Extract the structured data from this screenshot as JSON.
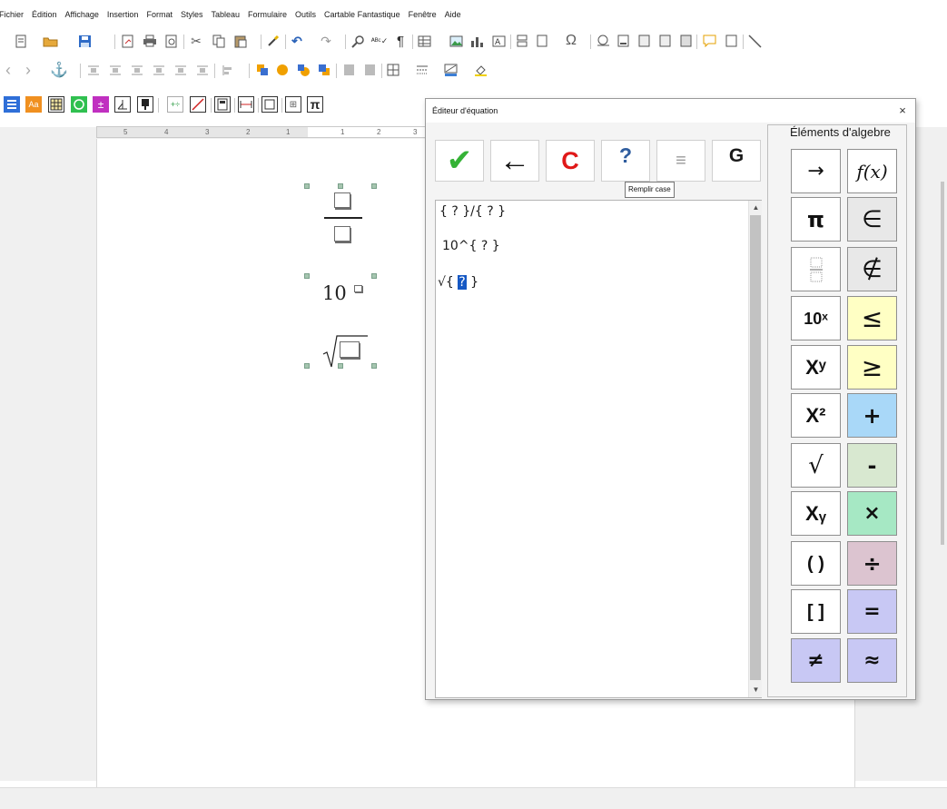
{
  "menubar": [
    "Fichier",
    "Édition",
    "Affichage",
    "Insertion",
    "Format",
    "Styles",
    "Tableau",
    "Formulaire",
    "Outils",
    "Cartable Fantastique",
    "Fenêtre",
    "Aide"
  ],
  "ruler": {
    "left_numbers": [
      "5",
      "4",
      "3",
      "2",
      "1"
    ],
    "right_numbers": [
      "1",
      "2",
      "3"
    ]
  },
  "document": {
    "power_base": "10"
  },
  "dialog": {
    "title": "Éditeur d'équation",
    "close_label": "×",
    "buttons": {
      "validate": "✔",
      "back": "←",
      "clear": "C",
      "help": "?",
      "align": "≡",
      "g": "G"
    },
    "tooltip": "Remplir case",
    "editor_lines": [
      "{ ? }/{ ? }",
      "10^{ ? }",
      "√{ ",
      "?",
      " }"
    ],
    "group_label": "Éléments d'algebre",
    "palette": [
      {
        "label": "→",
        "bg": "#ffffff"
      },
      {
        "label": "f(x)",
        "bg": "#ffffff"
      },
      {
        "label": "π",
        "bg": "#ffffff"
      },
      {
        "label": "∈",
        "bg": "#e8e8e8"
      },
      {
        "label": "fraction",
        "bg": "#ffffff"
      },
      {
        "label": "∉",
        "bg": "#e8e8e8"
      },
      {
        "label": "10ˣ",
        "bg": "#ffffff"
      },
      {
        "label": "≤",
        "bg": "#ffffc4"
      },
      {
        "label": "Xʸ",
        "bg": "#ffffff"
      },
      {
        "label": "≥",
        "bg": "#ffffc4"
      },
      {
        "label": "X²",
        "bg": "#ffffff"
      },
      {
        "label": "+",
        "bg": "#a9d8f8"
      },
      {
        "label": "√",
        "bg": "#ffffff"
      },
      {
        "label": "-",
        "bg": "#d8e8d0"
      },
      {
        "label": "Xᵧ",
        "bg": "#ffffff"
      },
      {
        "label": "×",
        "bg": "#a6e8c4"
      },
      {
        "label": "( )",
        "bg": "#ffffff"
      },
      {
        "label": "÷",
        "bg": "#dcc4d0"
      },
      {
        "label": "[ ]",
        "bg": "#ffffff"
      },
      {
        "label": "=",
        "bg": "#c8c8f4"
      },
      {
        "label": "≠",
        "bg": "#c8c8f4"
      },
      {
        "label": "≈",
        "bg": "#c8c8f4"
      }
    ]
  }
}
